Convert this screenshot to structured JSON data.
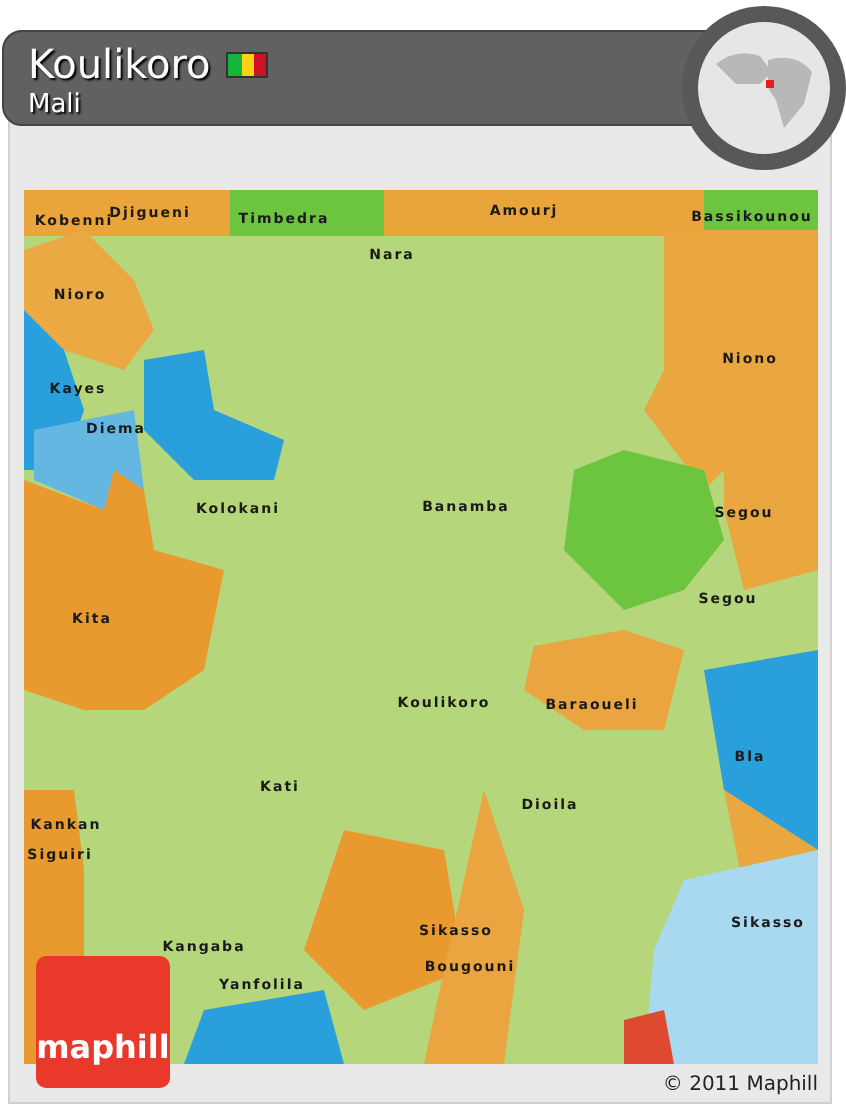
{
  "header": {
    "title": "Koulikoro",
    "subtitle": "Mali"
  },
  "map": {
    "labels": [
      {
        "text": "Kobenni"
      },
      {
        "text": "Djigueni"
      },
      {
        "text": "Timbedra"
      },
      {
        "text": "Amourj"
      },
      {
        "text": "Bassikounou"
      },
      {
        "text": "Nara"
      },
      {
        "text": "Nioro"
      },
      {
        "text": "Kayes"
      },
      {
        "text": "Diema"
      },
      {
        "text": "Niono"
      },
      {
        "text": "Kolokani"
      },
      {
        "text": "Banamba"
      },
      {
        "text": "Segou"
      },
      {
        "text": "Segou"
      },
      {
        "text": "Kita"
      },
      {
        "text": "Koulikoro"
      },
      {
        "text": "Baraoueli"
      },
      {
        "text": "Kati"
      },
      {
        "text": "Bla"
      },
      {
        "text": "Dioila"
      },
      {
        "text": "Kankan"
      },
      {
        "text": "Siguiri"
      },
      {
        "text": "Kangaba"
      },
      {
        "text": "Sikasso"
      },
      {
        "text": "Sikasso"
      },
      {
        "text": "Bougouni"
      },
      {
        "text": "Yanfolila"
      }
    ]
  },
  "logo": {
    "text": "maphill"
  },
  "footer": {
    "copyright": "© 2011 Maphill"
  }
}
